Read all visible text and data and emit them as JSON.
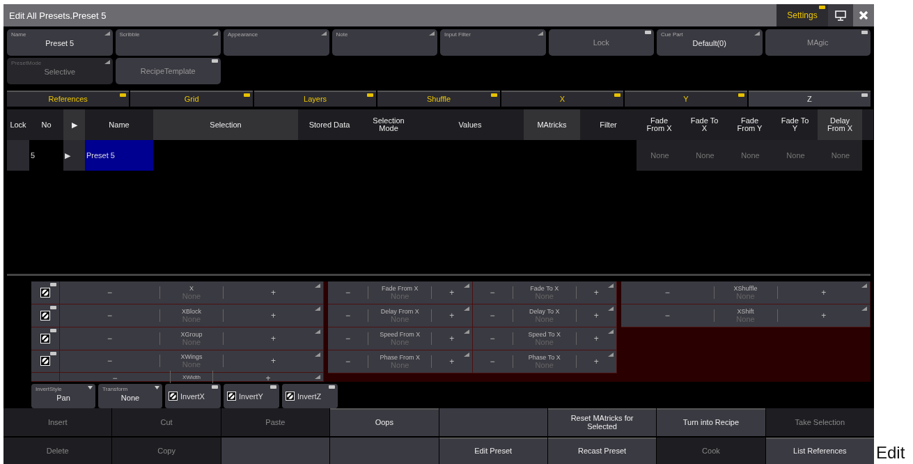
{
  "window": {
    "title": "Edit All Presets.Preset 5",
    "settings": {
      "label": "Settings",
      "on": true
    }
  },
  "properties": [
    {
      "kind": "field",
      "label": "Name",
      "value": "Preset 5"
    },
    {
      "kind": "field",
      "label": "Scribble"
    },
    {
      "kind": "field",
      "label": "Appearance"
    },
    {
      "kind": "field",
      "label": "Note"
    },
    {
      "kind": "field",
      "label": "Input Filter"
    },
    {
      "kind": "toggle",
      "value": "Lock",
      "on": false
    },
    {
      "kind": "field",
      "label": "Cue Part",
      "value": "Default(0)"
    },
    {
      "kind": "toggle",
      "value": "MAgic",
      "on": false
    },
    {
      "kind": "field",
      "label": "PresetMode",
      "value": "Selective",
      "disabled": true
    },
    {
      "kind": "toggle",
      "value": "RecipeTemplate",
      "on": false
    }
  ],
  "tabs": [
    {
      "label": "References",
      "on": true,
      "selected": false
    },
    {
      "label": "Grid",
      "on": true,
      "selected": false
    },
    {
      "label": "Layers",
      "on": true,
      "selected": false
    },
    {
      "label": "Shuffle",
      "on": true,
      "selected": false
    },
    {
      "label": "X",
      "on": true,
      "selected": false
    },
    {
      "label": "Y",
      "on": true,
      "selected": false
    },
    {
      "label": "Z",
      "on": false,
      "selected": true
    }
  ],
  "table": {
    "columns": [
      "Lock",
      "No",
      "▶",
      "Name",
      "Selection",
      "Stored Data",
      "Selection Mode",
      "Values",
      "MAtricks",
      "Filter",
      "Fade From X",
      "Fade To X",
      "Fade From Y",
      "Fade To Y",
      "Delay From X"
    ],
    "rows": [
      {
        "selected": true,
        "cells": [
          "",
          "5",
          "▶",
          "Preset 5",
          "",
          "",
          "",
          "",
          "",
          "",
          "None",
          "None",
          "None",
          "None",
          "None"
        ]
      }
    ]
  },
  "encoders": {
    "left": [
      {
        "label": "X",
        "value": "None",
        "on": false
      },
      {
        "label": "XBlock",
        "value": "None",
        "on": false
      },
      {
        "label": "XGroup",
        "value": "None",
        "on": false
      },
      {
        "label": "XWings",
        "value": "None",
        "on": false
      },
      {
        "label": "XWidth"
      }
    ],
    "middle": [
      [
        {
          "label": "Fade From X",
          "value": "None"
        },
        {
          "label": "Fade To X",
          "value": "None"
        }
      ],
      [
        {
          "label": "Delay From X",
          "value": "None"
        },
        {
          "label": "Delay To X",
          "value": "None"
        }
      ],
      [
        {
          "label": "Speed From X",
          "value": "None"
        },
        {
          "label": "Speed To X",
          "value": "None"
        }
      ],
      [
        {
          "label": "Phase From X",
          "value": "None"
        },
        {
          "label": "Phase To X",
          "value": "None"
        }
      ]
    ],
    "right": [
      {
        "label": "XShuffle",
        "value": "None"
      },
      {
        "label": "XShift",
        "value": "None"
      }
    ],
    "minus": "−",
    "plus": "+"
  },
  "invert": [
    {
      "kind": "dropdown",
      "label": "InvertStyle",
      "value": "Pan"
    },
    {
      "kind": "dropdown",
      "label": "Transform",
      "value": "None"
    },
    {
      "kind": "toggle",
      "value": "InvertX",
      "on": false
    },
    {
      "kind": "toggle",
      "value": "InvertY",
      "on": false
    },
    {
      "kind": "toggle",
      "value": "InvertZ",
      "on": false
    }
  ],
  "buttons": [
    [
      {
        "kind": "button",
        "label": "Insert",
        "disabled": true
      },
      {
        "kind": "button",
        "label": "Cut",
        "disabled": true
      },
      {
        "kind": "button",
        "label": "Paste",
        "disabled": true
      },
      {
        "kind": "button",
        "label": "Oops",
        "disabled": false
      },
      {
        "kind": "blank"
      },
      {
        "kind": "button",
        "label": "Reset MAtricks for Selected",
        "disabled": false
      },
      {
        "kind": "button",
        "label": "Turn into Recipe",
        "disabled": false
      },
      {
        "kind": "button",
        "label": "Take Selection",
        "disabled": true
      }
    ],
    [
      {
        "kind": "button",
        "label": "Delete",
        "disabled": true
      },
      {
        "kind": "button",
        "label": "Copy",
        "disabled": true
      },
      {
        "kind": "blank"
      },
      {
        "kind": "blank"
      },
      {
        "kind": "button",
        "label": "Edit Preset",
        "disabled": false
      },
      {
        "kind": "button",
        "label": "Recast Preset",
        "disabled": false
      },
      {
        "kind": "button",
        "label": "Cook",
        "disabled": true
      },
      {
        "kind": "button",
        "label": "List References",
        "disabled": false
      }
    ]
  ],
  "outside_text": "Edit"
}
